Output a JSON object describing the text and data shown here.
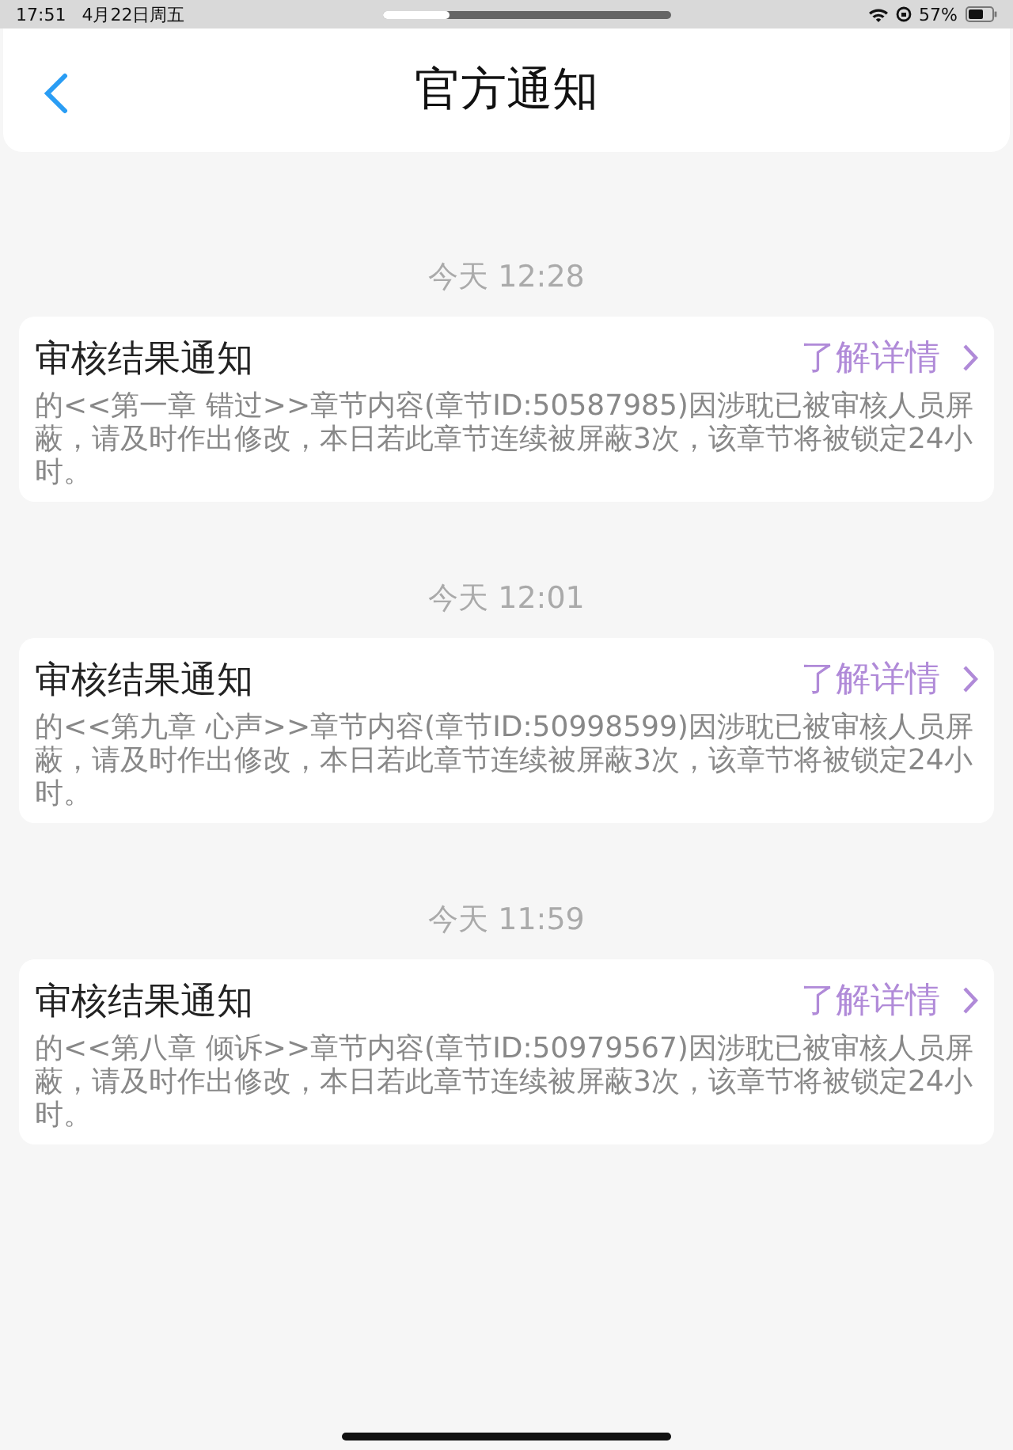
{
  "status_bar": {
    "time": "17:51",
    "date": "4月22日周五",
    "battery": "57%"
  },
  "nav": {
    "title": "官方通知"
  },
  "notifications": [
    {
      "time": "今天 12:28",
      "title": "审核结果通知",
      "link": "了解详情",
      "body": "的<<第一章 错过>>章节内容(章节ID:50587985)因涉耽已被审核人员屏蔽，请及时作出修改，本日若此章节连续被屏蔽3次，该章节将被锁定24小时。"
    },
    {
      "time": "今天 12:01",
      "title": "审核结果通知",
      "link": "了解详情",
      "body": "的<<第九章 心声>>章节内容(章节ID:50998599)因涉耽已被审核人员屏蔽，请及时作出修改，本日若此章节连续被屏蔽3次，该章节将被锁定24小时。"
    },
    {
      "time": "今天 11:59",
      "title": "审核结果通知",
      "link": "了解详情",
      "body": "的<<第八章 倾诉>>章节内容(章节ID:50979567)因涉耽已被审核人员屏蔽，请及时作出修改，本日若此章节连续被屏蔽3次，该章节将被锁定24小时。"
    }
  ]
}
